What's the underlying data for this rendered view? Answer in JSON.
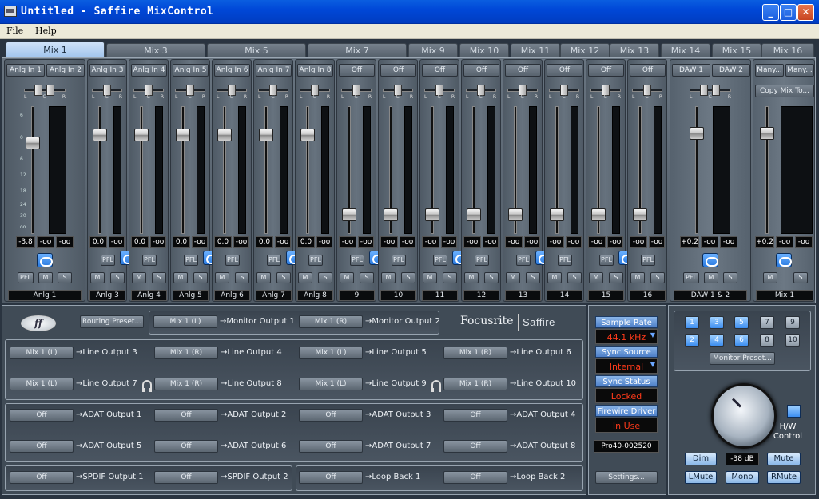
{
  "window": {
    "title": "Untitled - Saffire MixControl",
    "minimize": "_",
    "maximize": "□",
    "close": "✕"
  },
  "menu": {
    "file": "File",
    "help": "Help"
  },
  "tabs": [
    "Mix 1",
    "Mix 3",
    "Mix 5",
    "Mix 7",
    "Mix 9",
    "Mix 10",
    "Mix 11",
    "Mix 12",
    "Mix 13",
    "Mix 14",
    "Mix 15",
    "Mix 16"
  ],
  "strips": {
    "s1": {
      "src_a": "Anlg In 1",
      "src_b": "Anlg In 2",
      "level": "-3.8",
      "meter_a": "-oo",
      "meter_b": "-oo",
      "pfl": "PFL",
      "m": "M",
      "s": "S",
      "name": "Anlg 1"
    },
    "s3": {
      "src": "Anlg In 3",
      "level": "0.0",
      "meter": "-oo",
      "pfl": "PFL",
      "m": "M",
      "s": "S",
      "name": "Anlg 3"
    },
    "s4": {
      "src": "Anlg In 4",
      "level": "0.0",
      "meter": "-oo",
      "pfl": "PFL",
      "m": "M",
      "s": "S",
      "name": "Anlg 4"
    },
    "s5": {
      "src": "Anlg In 5",
      "level": "0.0",
      "meter": "-oo",
      "pfl": "PFL",
      "m": "M",
      "s": "S",
      "name": "Anlg 5"
    },
    "s6": {
      "src": "Anlg In 6",
      "level": "0.0",
      "meter": "-oo",
      "pfl": "PFL",
      "m": "M",
      "s": "S",
      "name": "Anlg 6"
    },
    "s7": {
      "src": "Anlg In 7",
      "level": "0.0",
      "meter": "-oo",
      "pfl": "PFL",
      "m": "M",
      "s": "S",
      "name": "Anlg 7"
    },
    "s8": {
      "src": "Anlg In 8",
      "level": "0.0",
      "meter": "-oo",
      "pfl": "PFL",
      "m": "M",
      "s": "S",
      "name": "Anlg 8"
    },
    "s9": {
      "src": "Off",
      "level": "-oo",
      "meter": "-oo",
      "pfl": "PFL",
      "m": "M",
      "s": "S",
      "name": "9"
    },
    "s10": {
      "src": "Off",
      "level": "-oo",
      "meter": "-oo",
      "pfl": "PFL",
      "m": "M",
      "s": "S",
      "name": "10"
    },
    "s11": {
      "src": "Off",
      "level": "-oo",
      "meter": "-oo",
      "pfl": "PFL",
      "m": "M",
      "s": "S",
      "name": "11"
    },
    "s12": {
      "src": "Off",
      "level": "-oo",
      "meter": "-oo",
      "pfl": "PFL",
      "m": "M",
      "s": "S",
      "name": "12"
    },
    "s13": {
      "src": "Off",
      "level": "-oo",
      "meter": "-oo",
      "pfl": "PFL",
      "m": "M",
      "s": "S",
      "name": "13"
    },
    "s14": {
      "src": "Off",
      "level": "-oo",
      "meter": "-oo",
      "pfl": "PFL",
      "m": "M",
      "s": "S",
      "name": "14"
    },
    "s15": {
      "src": "Off",
      "level": "-oo",
      "meter": "-oo",
      "pfl": "PFL",
      "m": "M",
      "s": "S",
      "name": "15"
    },
    "s16": {
      "src": "Off",
      "level": "-oo",
      "meter": "-oo",
      "pfl": "PFL",
      "m": "M",
      "s": "S",
      "name": "16"
    },
    "daw": {
      "src_a": "DAW 1",
      "src_b": "DAW 2",
      "level": "+0.2",
      "meter_a": "-oo",
      "meter_b": "-oo",
      "pfl": "PFL",
      "m": "M",
      "s": "S",
      "name": "DAW 1 & 2"
    },
    "mix": {
      "src_a": "Many...",
      "src_b": "Many...",
      "copy": "Copy Mix To...",
      "level": "+0.2",
      "meter_a": "-oo",
      "meter_b": "-oo",
      "m": "M",
      "s": "S",
      "name": "Mix 1"
    }
  },
  "pan_labels": {
    "l": "L",
    "c": "C",
    "r": "R"
  },
  "fader_scale": {
    "a": "6",
    "b": "0",
    "c": "6",
    "d": "12",
    "e": "18",
    "f": "24",
    "g": "30",
    "h": "42",
    "i": "oo"
  },
  "routing": {
    "preset_button": "Routing Preset...",
    "logo": "ff",
    "brand": "Focusrite",
    "brand2": "Saffire",
    "monitor": [
      {
        "src": "Mix 1 (L)",
        "dest": "→Monitor Output 1"
      },
      {
        "src": "Mix 1 (R)",
        "dest": "→Monitor Output 2"
      }
    ],
    "line_row1": [
      {
        "src": "Mix 1 (L)",
        "dest": "→Line Output 3"
      },
      {
        "src": "Mix 1 (R)",
        "dest": "→Line Output 4"
      },
      {
        "src": "Mix 1 (L)",
        "dest": "→Line Output 5"
      },
      {
        "src": "Mix 1 (R)",
        "dest": "→Line Output 6"
      }
    ],
    "line_row2": [
      {
        "src": "Mix 1 (L)",
        "dest": "→Line Output 7"
      },
      {
        "src": "Mix 1 (R)",
        "dest": "→Line Output 8"
      },
      {
        "src": "Mix 1 (L)",
        "dest": "→Line Output 9"
      },
      {
        "src": "Mix 1 (R)",
        "dest": "→Line Output 10"
      }
    ],
    "adat_row1": [
      {
        "src": "Off",
        "dest": "→ADAT Output 1"
      },
      {
        "src": "Off",
        "dest": "→ADAT Output 2"
      },
      {
        "src": "Off",
        "dest": "→ADAT Output 3"
      },
      {
        "src": "Off",
        "dest": "→ADAT Output 4"
      }
    ],
    "adat_row2": [
      {
        "src": "Off",
        "dest": "→ADAT Output 5"
      },
      {
        "src": "Off",
        "dest": "→ADAT Output 6"
      },
      {
        "src": "Off",
        "dest": "→ADAT Output 7"
      },
      {
        "src": "Off",
        "dest": "→ADAT Output 8"
      }
    ],
    "spdif": [
      {
        "src": "Off",
        "dest": "→SPDIF Output 1"
      },
      {
        "src": "Off",
        "dest": "→SPDIF Output 2"
      }
    ],
    "loopback": [
      {
        "src": "Off",
        "dest": "→Loop Back 1"
      },
      {
        "src": "Off",
        "dest": "→Loop Back 2"
      }
    ]
  },
  "status": {
    "sample_rate_label": "Sample Rate",
    "sample_rate": "44.1 kHz",
    "sync_source_label": "Sync Source",
    "sync_source": "Internal",
    "sync_status_label": "Sync Status",
    "sync_status": "Locked",
    "firewire_label": "Firewire Driver",
    "firewire": "In Use",
    "device": "Pro40-002520",
    "settings": "Settings..."
  },
  "monitor": {
    "buttons": [
      "1",
      "3",
      "5",
      "7",
      "9",
      "2",
      "4",
      "6",
      "8",
      "10"
    ],
    "preset": "Monitor Preset...",
    "dim": "Dim",
    "db": "-38 dB",
    "mute": "Mute",
    "lmute": "LMute",
    "mono": "Mono",
    "rmute": "RMute",
    "hw_label_1": "H/W",
    "hw_label_2": "Control"
  }
}
